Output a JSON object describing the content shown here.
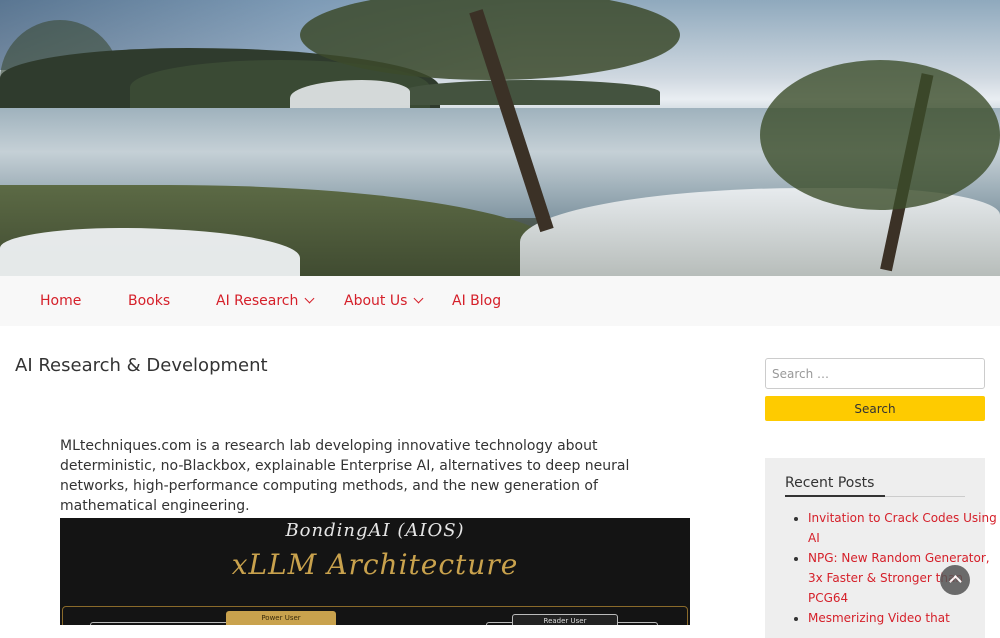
{
  "nav": {
    "items": [
      {
        "label": "Home"
      },
      {
        "label": "Books"
      },
      {
        "label": "AI Research"
      },
      {
        "label": "About Us"
      },
      {
        "label": "AI Blog"
      }
    ]
  },
  "main": {
    "title": "AI Research & Development",
    "intro": "MLtechniques.com is a research lab developing innovative technology about deterministic, no-Blackbox, explainable Enterprise AI, alternatives to deep neural networks, high-performance computing methods, and the new generation of mathematical engineering.",
    "feature_image": {
      "subtitle": "BondingAI (AIOS)",
      "title": "xLLM Architecture",
      "label_power": "Power User",
      "label_reader": "Reader User"
    }
  },
  "sidebar": {
    "search": {
      "placeholder": "Search …",
      "button_label": "Search"
    },
    "recent_posts": {
      "title": "Recent Posts",
      "items": [
        {
          "label": "Invitation to Crack Codes Using AI"
        },
        {
          "label": "NPG: New Random Generator, 3x Faster & Stronger than PCG64"
        },
        {
          "label": "Mesmerizing Video that"
        }
      ]
    }
  },
  "colors": {
    "link": "#d5202a",
    "search_button": "#fecb00",
    "feature_bg": "#141414",
    "feature_gold": "#c9a24d"
  }
}
